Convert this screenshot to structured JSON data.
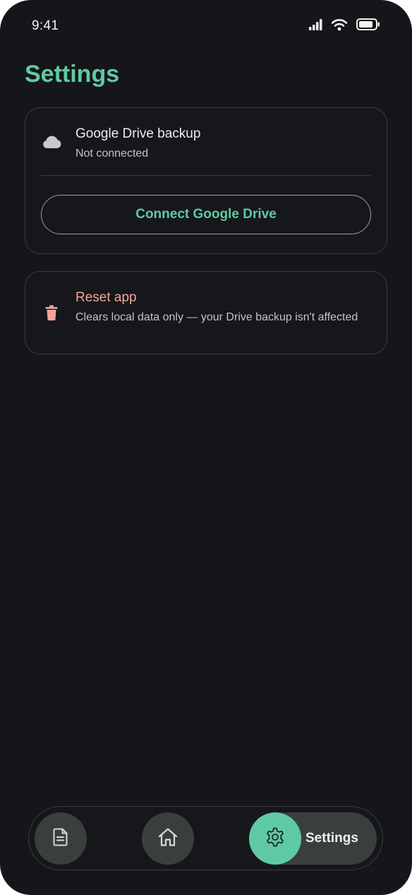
{
  "status_bar": {
    "time": "9:41",
    "icons": [
      "signal-icon",
      "wifi-icon",
      "battery-icon"
    ]
  },
  "header": {
    "title": "Settings"
  },
  "drive_card": {
    "icon": "cloud-icon",
    "title": "Google Drive backup",
    "subtitle": "Not connected",
    "button_label": "Connect Google Drive"
  },
  "reset_card": {
    "icon": "trash-icon",
    "title": "Reset app",
    "subtitle": "Clears local data only — your Drive backup isn't affected"
  },
  "bottom_nav": {
    "items": [
      {
        "icon": "document-icon",
        "active": false
      },
      {
        "icon": "home-icon",
        "active": false
      },
      {
        "icon": "gear-icon",
        "label": "Settings",
        "active": true
      }
    ]
  },
  "colors": {
    "background": "#151619",
    "accent": "#5fc9a5",
    "danger": "#f2a49b",
    "border": "#3a3c40",
    "nav_button": "#3a3f3d"
  }
}
